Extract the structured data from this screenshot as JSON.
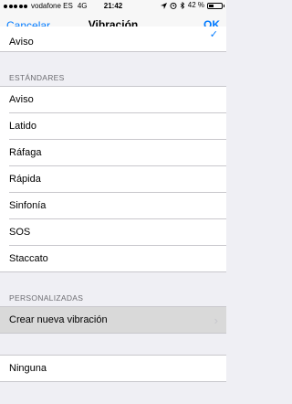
{
  "status": {
    "carrier": "vodafone ES",
    "network": "4G",
    "time": "21:42",
    "battery_pct": "42 %",
    "battery_level": 0.42,
    "icons": [
      "signal-dots-icon",
      "location-icon",
      "alarm-icon",
      "bluetooth-icon",
      "battery-icon"
    ]
  },
  "nav": {
    "cancel": "Cancelar",
    "title": "Vibración",
    "ok": "OK"
  },
  "top_item": {
    "label": "Aviso",
    "checked": true
  },
  "standard": {
    "header": "ESTÁNDARES",
    "items": [
      "Aviso",
      "Latido",
      "Ráfaga",
      "Rápida",
      "Sinfonía",
      "SOS",
      "Staccato"
    ]
  },
  "custom": {
    "header": "PERSONALIZADAS",
    "create": "Crear nueva vibración"
  },
  "none": {
    "label": "Ninguna"
  },
  "colors": {
    "accent": "#007aff",
    "background": "#efeff4",
    "separator": "#c8c7cc"
  }
}
